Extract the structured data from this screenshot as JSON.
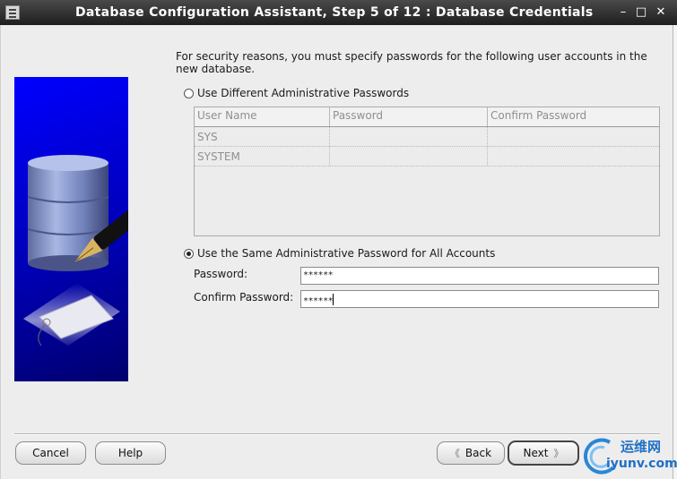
{
  "window": {
    "title": "Database Configuration Assistant, Step 5 of 12 : Database Credentials",
    "minimize_glyph": "–",
    "maximize_glyph": "□",
    "close_glyph": "✕"
  },
  "intro_text": "For security reasons, you must specify passwords for the following user accounts in the new database.",
  "option_different": {
    "label": "Use Different Administrative Passwords",
    "selected": false
  },
  "accounts_table": {
    "columns": [
      "User Name",
      "Password",
      "Confirm Password"
    ],
    "rows": [
      {
        "user": "SYS",
        "password": "",
        "confirm": ""
      },
      {
        "user": "SYSTEM",
        "password": "",
        "confirm": ""
      }
    ]
  },
  "option_same": {
    "label": "Use the Same Administrative Password for All Accounts",
    "selected": true
  },
  "password_field": {
    "label": "Password:",
    "value": "******"
  },
  "confirm_password_field": {
    "label": "Confirm Password:",
    "value": "******"
  },
  "buttons": {
    "cancel": "Cancel",
    "help": "Help",
    "back": "Back",
    "next": "Next",
    "back_glyph": "《",
    "next_glyph": "》"
  },
  "watermark": {
    "line1": "运维网",
    "line2": "iyunv.com"
  },
  "colors": {
    "titlebar": "#2e2e2e",
    "dialog_bg": "#ededed",
    "illustration_blue": "#0000d8",
    "watermark_blue": "#1f6fc4"
  }
}
